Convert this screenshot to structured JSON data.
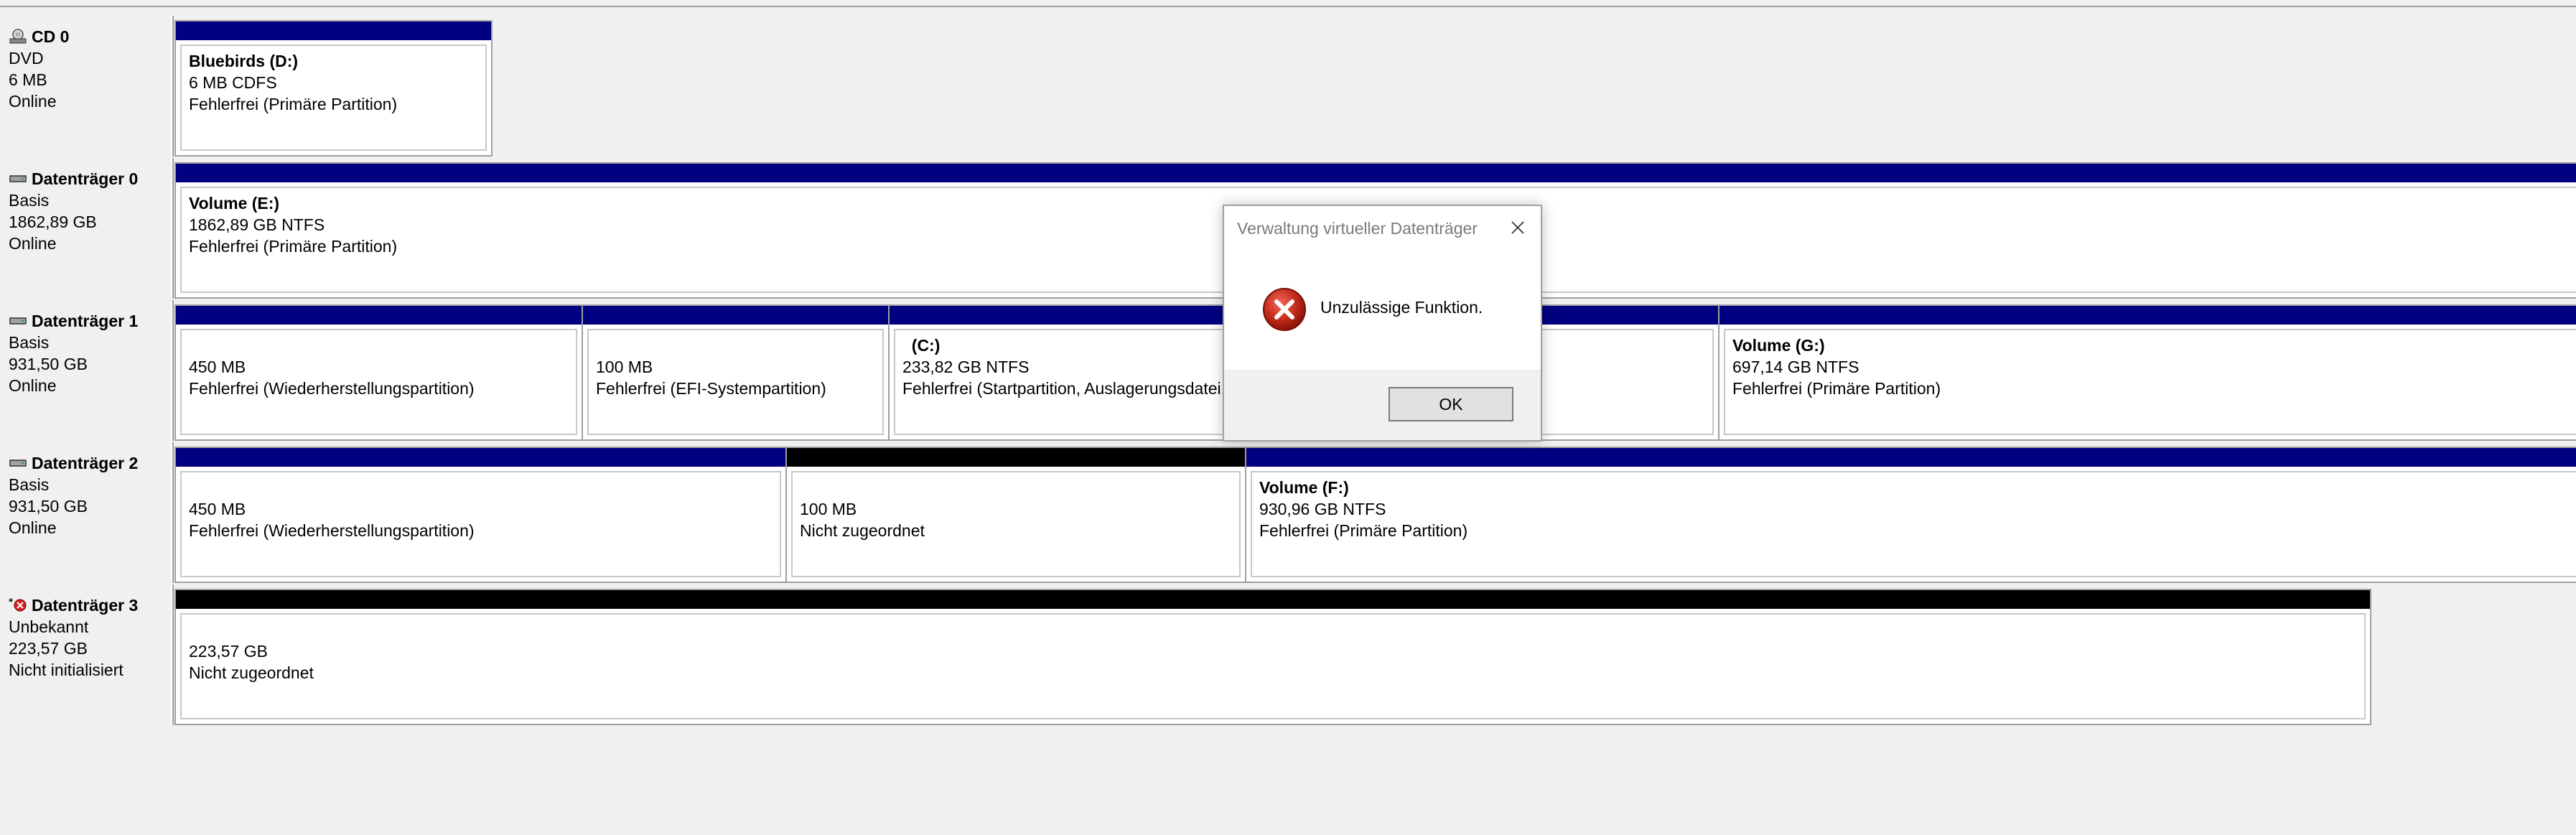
{
  "disks": [
    {
      "name": "CD 0",
      "lines": [
        "DVD",
        "6 MB",
        "Online"
      ],
      "icon": "cd-drive-icon",
      "partitions": [
        {
          "title": "Bluebirds  (D:)",
          "size": "6 MB CDFS",
          "status": "Fehlerfrei (Primäre Partition)",
          "bar": "blue"
        }
      ]
    },
    {
      "name": "Datenträger 0",
      "lines": [
        "Basis",
        "1862,89 GB",
        "Online"
      ],
      "icon": "hard-disk-icon",
      "partitions": [
        {
          "title": "Volume  (E:)",
          "size": "1862,89 GB NTFS",
          "status": "Fehlerfrei (Primäre Partition)",
          "bar": "blue"
        }
      ]
    },
    {
      "name": "Datenträger 1",
      "lines": [
        "Basis",
        "931,50 GB",
        "Online"
      ],
      "icon": "hard-disk-icon",
      "partitions": [
        {
          "title": "",
          "size": "450 MB",
          "status": "Fehlerfrei (Wiederherstellungspartition)",
          "bar": "blue"
        },
        {
          "title": "",
          "size": "100 MB",
          "status": "Fehlerfrei (EFI-Systempartition)",
          "bar": "blue"
        },
        {
          "title": "  (C:)",
          "size": "233,82 GB NTFS",
          "status": "Fehlerfrei (Startpartition, Auslagerungsdatei, Absturzabbild, Primäre Partition)",
          "bar": "blue"
        },
        {
          "title": "Volume  (G:)",
          "size": "697,14 GB NTFS",
          "status": "Fehlerfrei (Primäre Partition)",
          "bar": "blue"
        }
      ]
    },
    {
      "name": "Datenträger 2",
      "lines": [
        "Basis",
        "931,50 GB",
        "Online"
      ],
      "icon": "hard-disk-icon",
      "partitions": [
        {
          "title": "",
          "size": "450 MB",
          "status": "Fehlerfrei (Wiederherstellungspartition)",
          "bar": "blue"
        },
        {
          "title": "",
          "size": "100 MB",
          "status": "Nicht zugeordnet",
          "bar": "black"
        },
        {
          "title": "Volume  (F:)",
          "size": "930,96 GB NTFS",
          "status": "Fehlerfrei (Primäre Partition)",
          "bar": "blue"
        }
      ]
    },
    {
      "name": "Datenträger 3",
      "lines": [
        "Unbekannt",
        "223,57 GB",
        "Nicht initialisiert"
      ],
      "icon": "uninitialized-disk-icon",
      "partitions": [
        {
          "title": "",
          "size": "223,57 GB",
          "status": "Nicht zugeordnet",
          "bar": "black"
        }
      ]
    }
  ],
  "dialog": {
    "title": "Verwaltung virtueller Datenträger",
    "message": "Unzulässige Funktion.",
    "ok_label": "OK",
    "icon": "error-icon"
  },
  "colors": {
    "primary_partition_bar": "#000080",
    "unallocated_bar": "#000000",
    "error_red": "#c42b1c"
  }
}
